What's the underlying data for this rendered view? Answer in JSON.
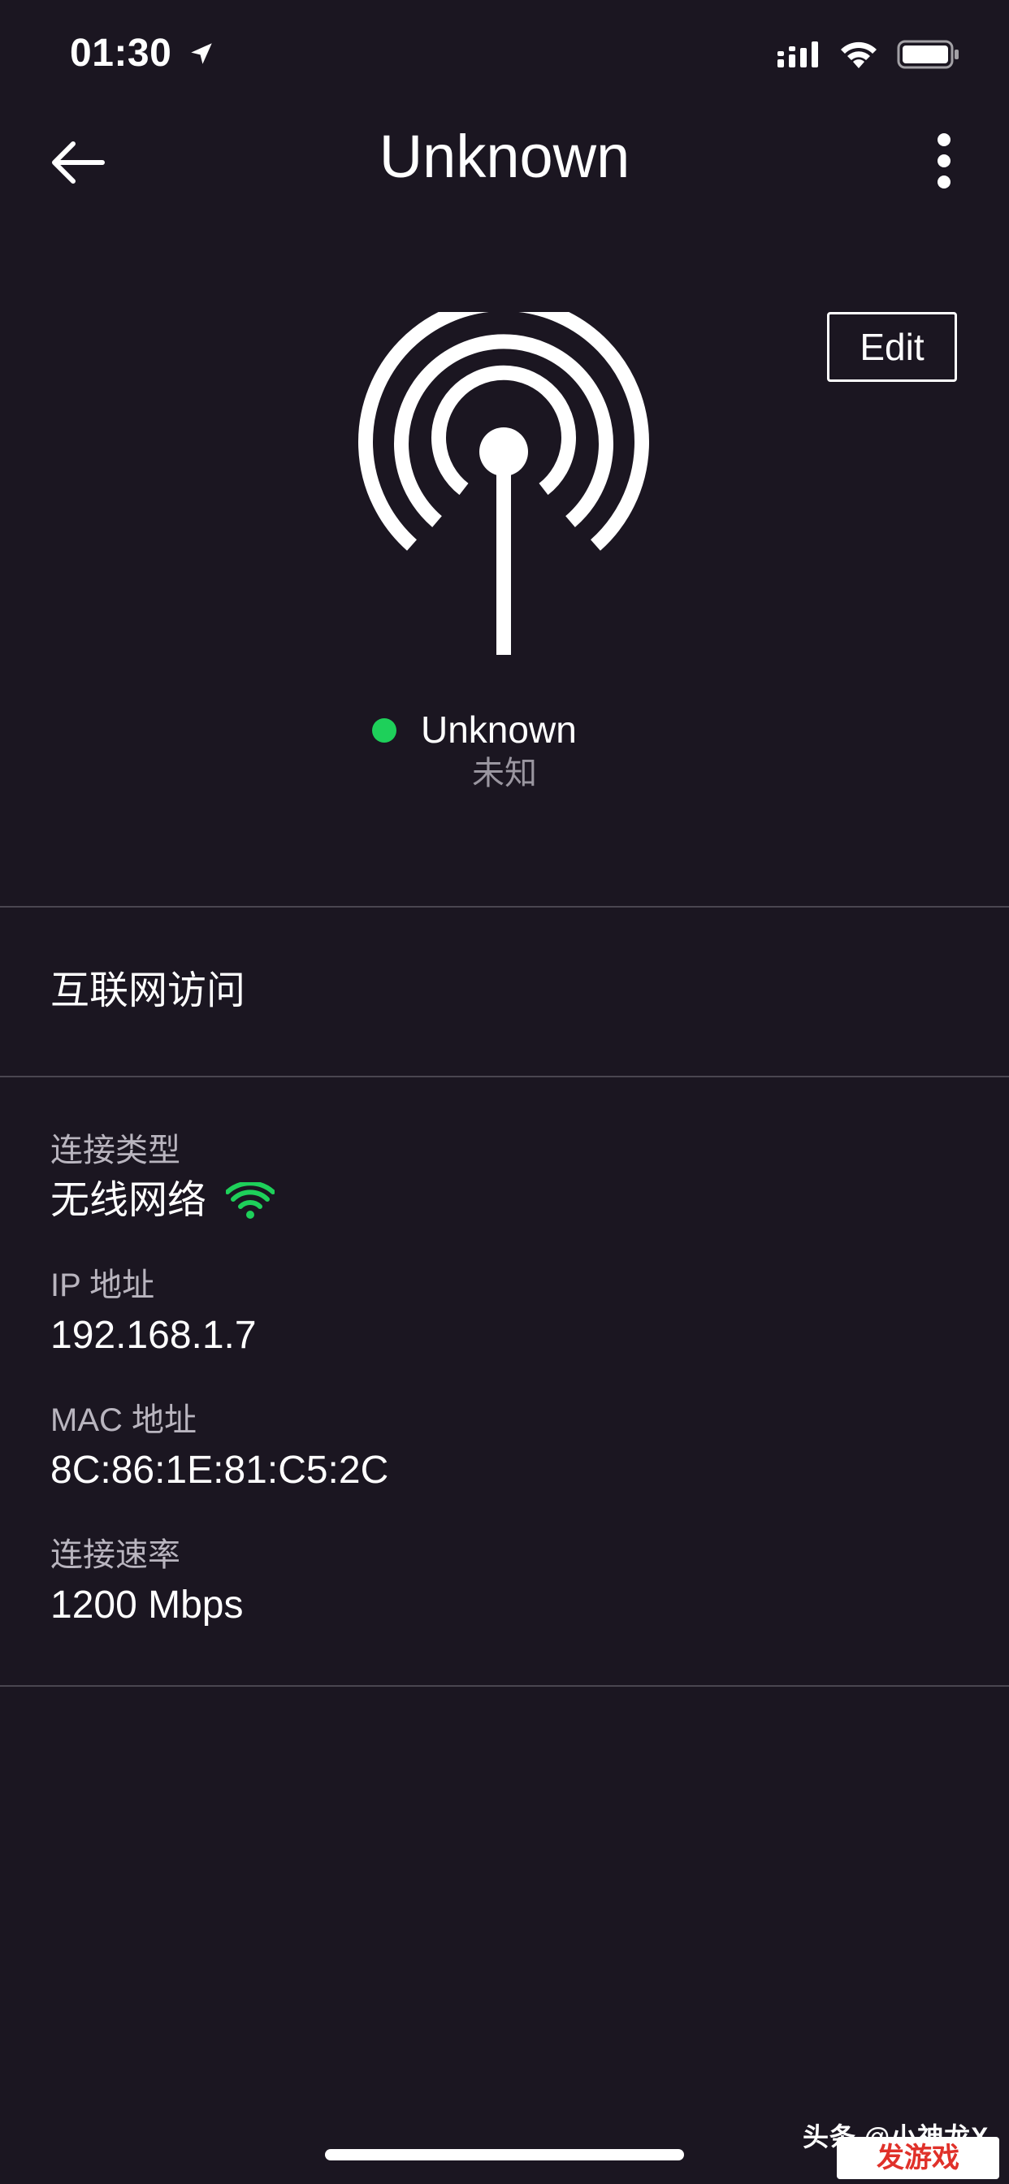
{
  "status_bar": {
    "time": "01:30"
  },
  "nav": {
    "title": "Unknown"
  },
  "edit_label": "Edit",
  "device": {
    "name": "Unknown",
    "subtitle": "未知",
    "status_color": "#1ed05a"
  },
  "internet_access_label": "互联网访问",
  "details": [
    {
      "label": "连接类型",
      "value": "无线网络"
    },
    {
      "label": "IP 地址",
      "value": "192.168.1.7"
    },
    {
      "label": "MAC 地址",
      "value": "8C:86:1E:81:C5:2C"
    },
    {
      "label": "连接速率",
      "value": "1200 Mbps"
    }
  ],
  "watermark": {
    "text": "头条 @小神龙X",
    "logo_text": "发游戏"
  },
  "icons": {
    "back": "arrow-left-icon",
    "more": "more-vertical-icon",
    "device": "antenna-broadcast-icon",
    "wifi": "wifi-icon",
    "location": "location-arrow-icon",
    "signal": "signal-icon",
    "battery": "battery-icon"
  }
}
